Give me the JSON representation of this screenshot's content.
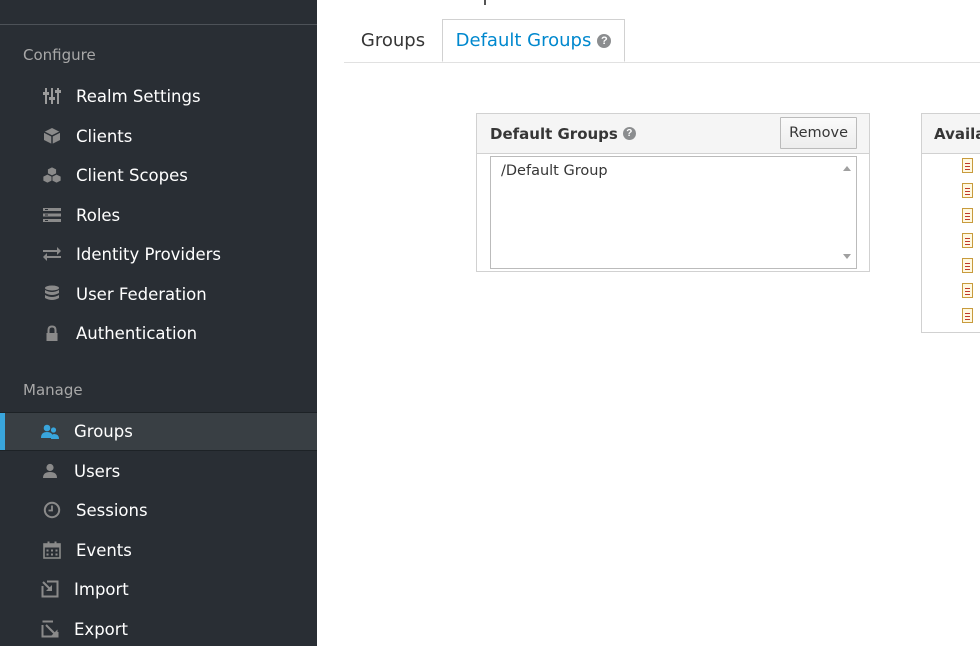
{
  "sidebar": {
    "configure_title": "Configure",
    "manage_title": "Manage",
    "configure_items": [
      {
        "label": "Realm Settings",
        "icon": "sliders-icon"
      },
      {
        "label": "Clients",
        "icon": "cube-icon"
      },
      {
        "label": "Client Scopes",
        "icon": "cubes-icon"
      },
      {
        "label": "Roles",
        "icon": "roles-icon"
      },
      {
        "label": "Identity Providers",
        "icon": "exchange-icon"
      },
      {
        "label": "User Federation",
        "icon": "database-icon"
      },
      {
        "label": "Authentication",
        "icon": "lock-icon"
      }
    ],
    "manage_items": [
      {
        "label": "Groups",
        "icon": "users-icon",
        "active": true
      },
      {
        "label": "Users",
        "icon": "user-icon"
      },
      {
        "label": "Sessions",
        "icon": "clock-icon"
      },
      {
        "label": "Events",
        "icon": "calendar-icon"
      },
      {
        "label": "Import",
        "icon": "import-icon"
      },
      {
        "label": "Export",
        "icon": "export-icon"
      }
    ]
  },
  "tabs": [
    {
      "label": "Groups",
      "active": false
    },
    {
      "label": "Default Groups",
      "active": true,
      "help": "?"
    }
  ],
  "default_groups_panel": {
    "title": "Default Groups",
    "help": "?",
    "remove_label": "Remove",
    "options": [
      "/Default Group"
    ]
  },
  "available_panel": {
    "title": "Availal"
  },
  "colors": {
    "sidebar_bg": "#292e34",
    "active_accent": "#39a5dc",
    "link_blue": "#0088ce"
  }
}
